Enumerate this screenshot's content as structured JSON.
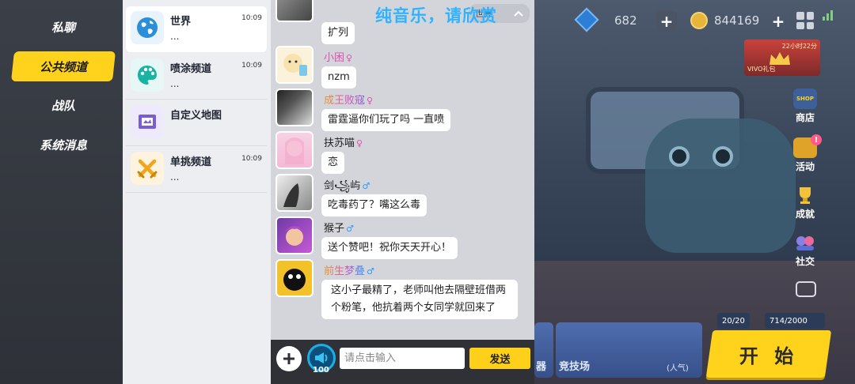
{
  "nav": {
    "items": [
      {
        "label": "私聊"
      },
      {
        "label": "公共频道"
      },
      {
        "label": "战队"
      },
      {
        "label": "系统消息"
      }
    ]
  },
  "channels": [
    {
      "name": "世界",
      "time": "10:09",
      "preview": "...",
      "icon": "globe-icon",
      "color": "#2a8fd8"
    },
    {
      "name": "喷涂频道",
      "time": "10:09",
      "preview": "...",
      "icon": "palette-icon",
      "color": "#17b3a3"
    },
    {
      "name": "自定义地图",
      "time": "",
      "preview": "",
      "icon": "map-icon",
      "color": "#7a5cd6"
    },
    {
      "name": "单挑频道",
      "time": "10:09",
      "preview": "...",
      "icon": "swords-icon",
      "color": "#f0a51a"
    }
  ],
  "chat": {
    "announcement": "纯音乐，请欣赏",
    "dropdown_label": "世界",
    "messages": [
      {
        "name": "",
        "gender": "",
        "text": "扩列"
      },
      {
        "name": "小困",
        "gender": "♀",
        "text": "nzm"
      },
      {
        "name": "成王败寇",
        "gender": "♀",
        "text": "雷霆逼你们玩了吗 一直喷"
      },
      {
        "name": "扶苏喵",
        "gender": "♀",
        "text": "恋"
      },
      {
        "name": "剑꧁屿",
        "gender": "♂",
        "text": "吃毒药了？嘴这么毒"
      },
      {
        "name": "猴子",
        "gender": "♂",
        "text": "送个赞吧！祝你天天开心！"
      },
      {
        "name": "前生梦叠",
        "gender": "♂",
        "text": "这小子最精了，老师叫他去隔壁班借两个粉笔，他抗着两个女同学就回来了"
      }
    ],
    "input_placeholder": "请点击输入",
    "send_label": "发送",
    "horn_count": "100"
  },
  "hud": {
    "gems": "682",
    "coins": "844169"
  },
  "vivo": {
    "timer": "22小时22分",
    "label": "VIVO礼包"
  },
  "side_menu": [
    {
      "label": "商店",
      "icon": "shop-icon",
      "top_text": "SHOP"
    },
    {
      "label": "活动",
      "icon": "gift-icon",
      "badge": "!"
    },
    {
      "label": "成就",
      "icon": "trophy-icon"
    },
    {
      "label": "社交",
      "icon": "friends-icon"
    }
  ],
  "bottom": {
    "stat_stamina": "20/20",
    "stat_progress": "714/2000",
    "mode_1": "竞技场",
    "mode_2": "器",
    "mode_popularity": "(人气)",
    "start_label": "开 始"
  },
  "colors": {
    "accent_yellow": "#ffd21c",
    "announcement_blue": "#2fb3ff",
    "female": "#e04fb0",
    "male": "#2d9cff"
  }
}
